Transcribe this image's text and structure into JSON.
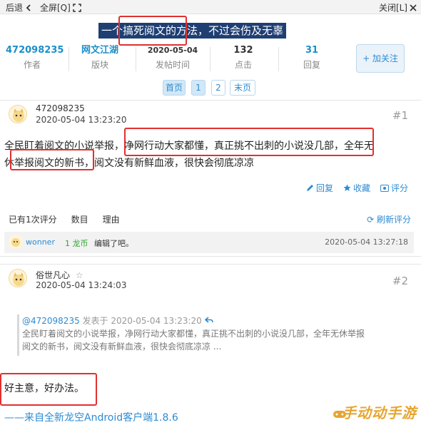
{
  "topbar": {
    "back_label": "后退",
    "fullscreen_label": "全屏[Q]",
    "close_label": "关闭[L]"
  },
  "thread": {
    "title": "一个搞死阅文的方法，不过会伤及无辜"
  },
  "stats": {
    "author_id": "472098235",
    "author_label": "作者",
    "board": "网文江湖",
    "board_label": "版块",
    "post_time": "2020-05-04",
    "post_time_label": "发帖时间",
    "clicks": "132",
    "clicks_label": "点击",
    "replies": "31",
    "replies_label": "回复",
    "follow_label": "+ 加关注"
  },
  "pager": {
    "first": "首页",
    "page1": "1",
    "page2": "2",
    "last": "末页"
  },
  "posts": [
    {
      "user": "472098235",
      "time": "2020-05-04 13:23:20",
      "floor": "#1",
      "line1": "全民盯着阅文的小说举报，净网行动大家都懂，真正挑不出刺的小说没几部，全年无",
      "line2": "休举报阅文的新书，阅文没有新鲜血液，很快会彻底凉凉",
      "reply_label": "回复",
      "fav_label": "收藏",
      "rate_label": "评分",
      "rating": {
        "summary": "已有1次评分",
        "col_amount": "数目",
        "col_reason": "理由",
        "refresh_label": "刷新评分",
        "rater": "wonner",
        "amount": "1 龙币",
        "reason": "编辑了吧。",
        "time": "2020-05-04 13:27:18"
      }
    },
    {
      "user": "俗世凡心",
      "star": "☆",
      "time": "2020-05-04 13:24:03",
      "floor": "#2",
      "quote_user": "@472098235",
      "quote_meta": "发表于 2020-05-04 13:23:20",
      "quote_line1": "全民盯着阅文的小说举报，净网行动大家都懂，真正挑不出刺的小说没几部，全年无休举报",
      "quote_line2": "阅文的新书，阅文没有新鲜血液，很快会彻底凉凉 ...",
      "body": "好主意，好办法。",
      "signature": "——来自全新龙空Android客户端1.8.6"
    }
  ],
  "watermark": "手动动手游",
  "colors": {
    "link_blue": "#2c8bd3",
    "highlight_red": "#e0302f",
    "title_bg": "#1f3f73"
  }
}
